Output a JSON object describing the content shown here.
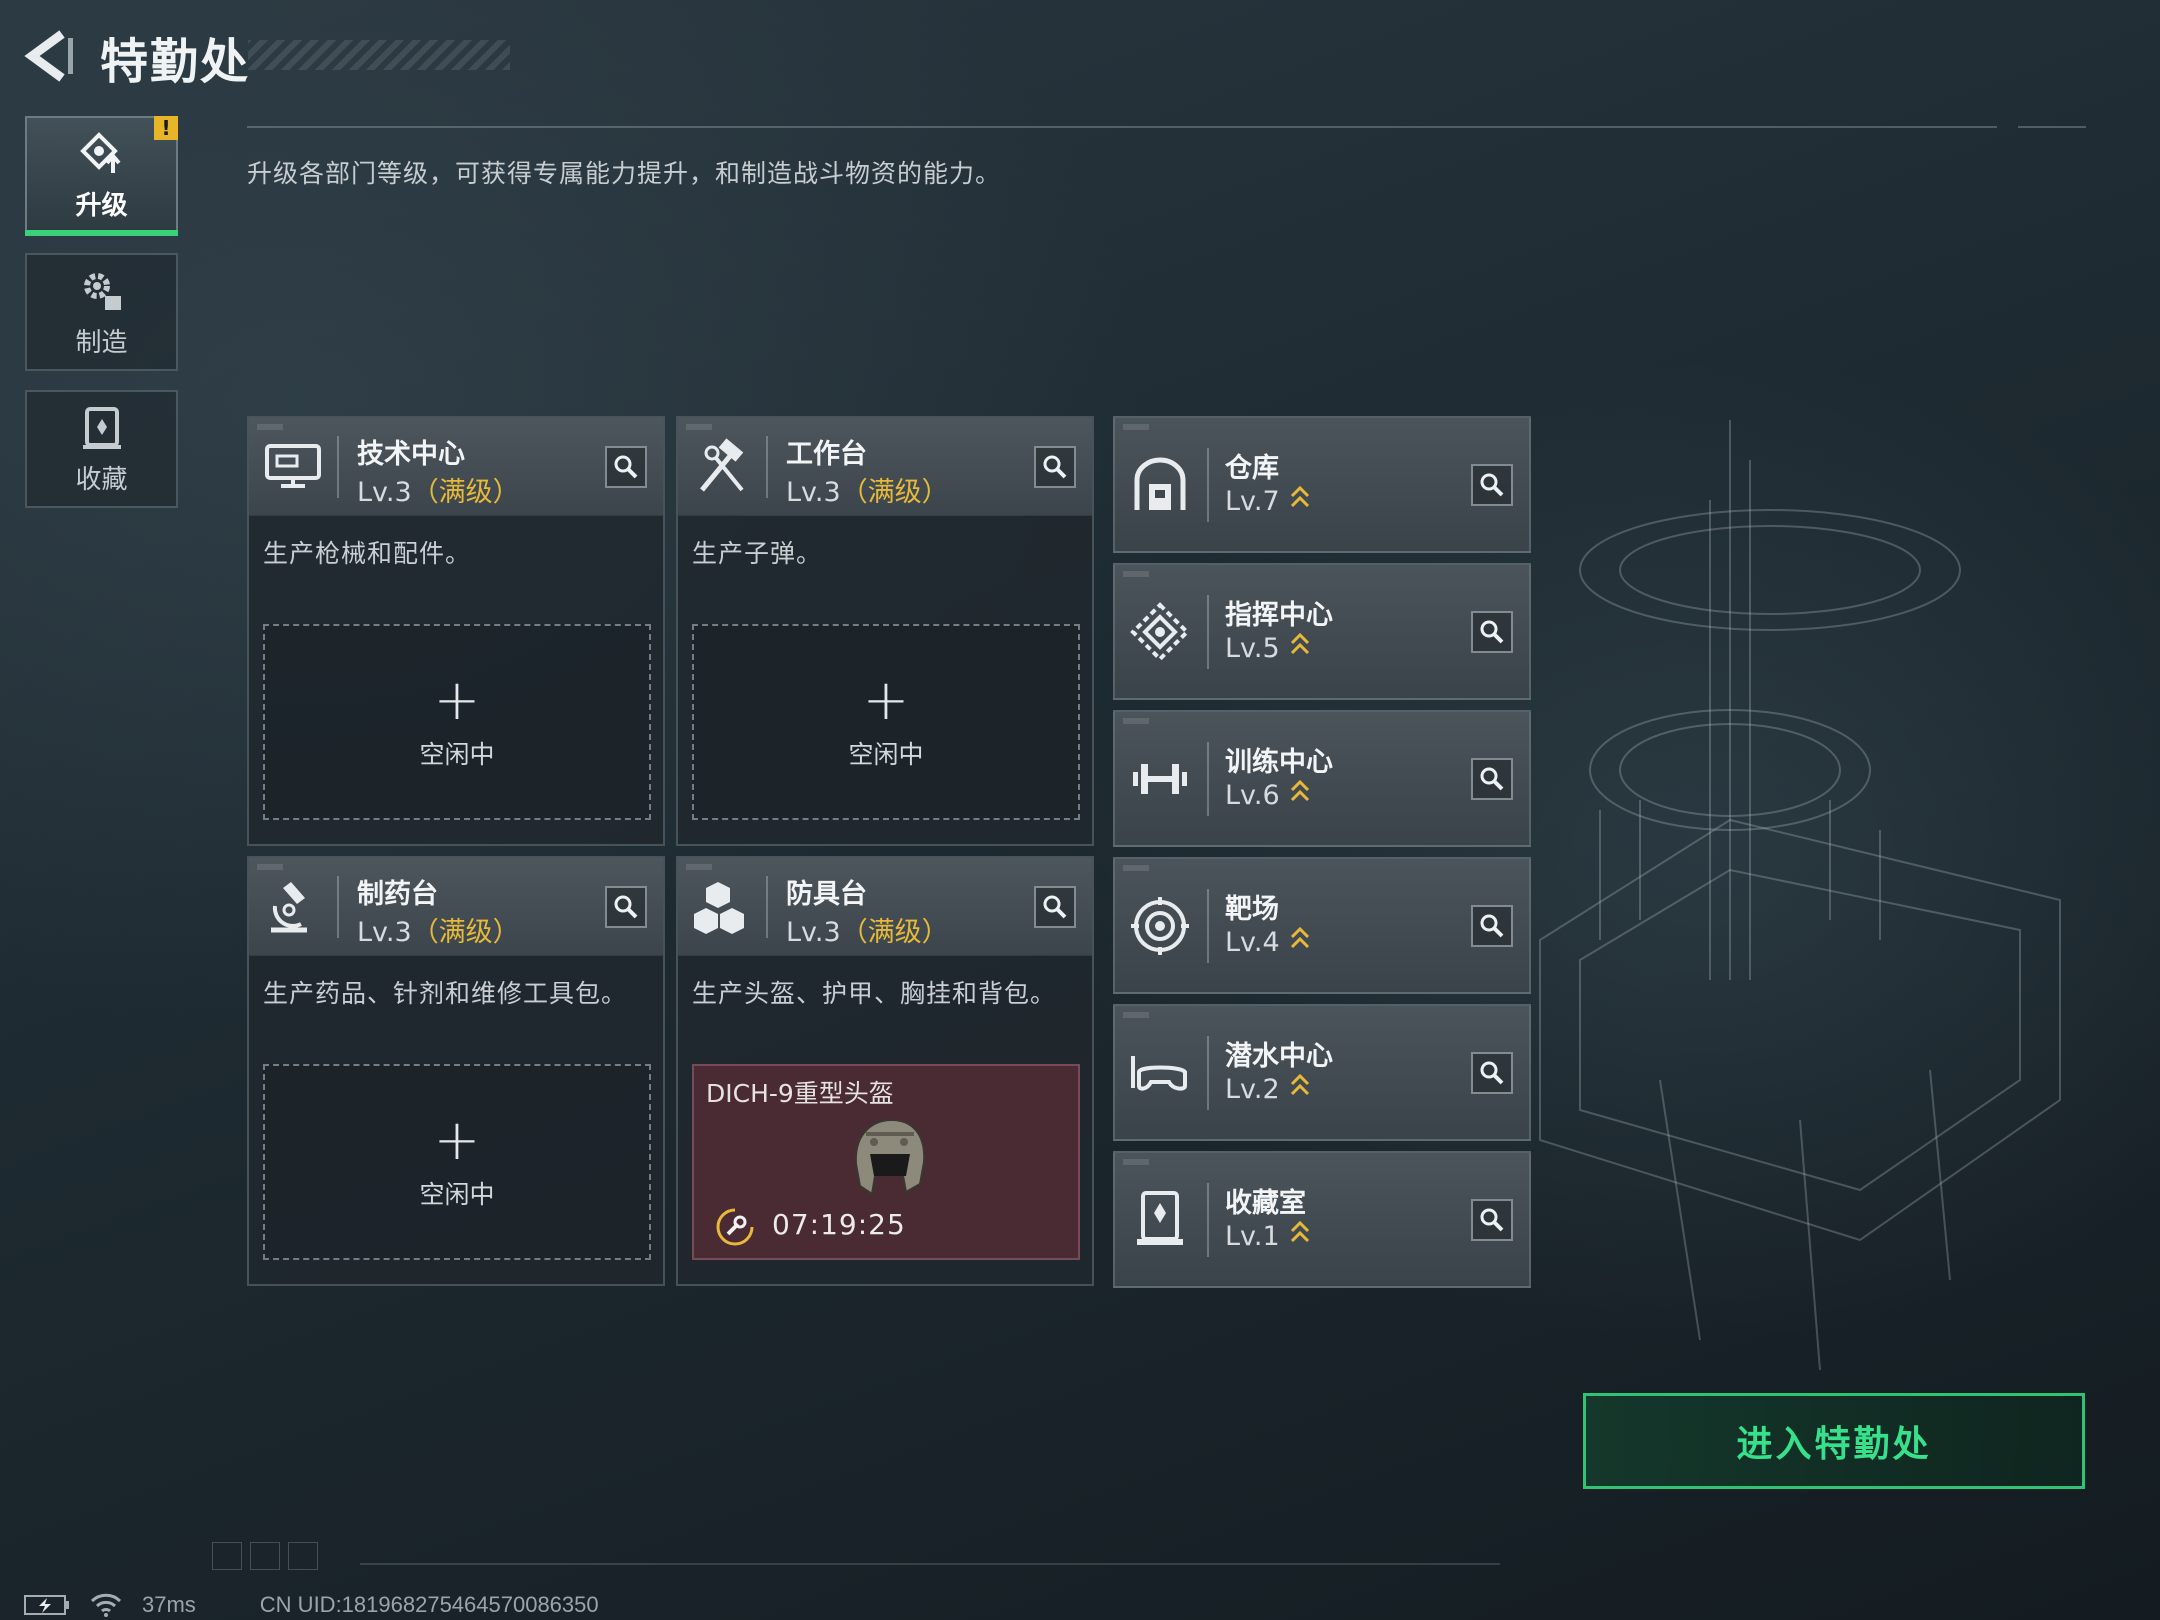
{
  "header": {
    "title": "特勤处"
  },
  "nav": {
    "tabs": [
      {
        "label": "升级",
        "active": true,
        "icon": "upgrade-icon"
      },
      {
        "label": "制造",
        "active": false,
        "icon": "gears-icon"
      },
      {
        "label": "收藏",
        "active": false,
        "icon": "collection-icon"
      }
    ],
    "alert": "!"
  },
  "description": "升级各部门等级，可获得专属能力提升，和制造战斗物资的能力。",
  "depts": [
    {
      "name": "技术中心",
      "level": "Lv.3",
      "maxed": "（满级）",
      "desc": "生产枪械和配件。",
      "slot_plus": "+",
      "slot_text": "空闲中",
      "icon": "computer-icon"
    },
    {
      "name": "工作台",
      "level": "Lv.3",
      "maxed": "（满级）",
      "desc": "生产子弹。",
      "slot_plus": "+",
      "slot_text": "空闲中",
      "icon": "hammer-wrench-icon"
    },
    {
      "name": "制药台",
      "level": "Lv.3",
      "maxed": "（满级）",
      "desc": "生产药品、针剂和维修工具包。",
      "slot_plus": "+",
      "slot_text": "空闲中",
      "icon": "microscope-icon"
    },
    {
      "name": "防具台",
      "level": "Lv.3",
      "maxed": "（满级）",
      "desc": "生产头盔、护甲、胸挂和背包。",
      "item_name": "DICH-9重型头盔",
      "timer": "07:19:25",
      "icon": "armor-blocks-icon"
    }
  ],
  "facilities": [
    {
      "name": "仓库",
      "level": "Lv.7",
      "icon": "warehouse-icon"
    },
    {
      "name": "指挥中心",
      "level": "Lv.5",
      "icon": "command-icon"
    },
    {
      "name": "训练中心",
      "level": "Lv.6",
      "icon": "dumbbell-icon"
    },
    {
      "name": "靶场",
      "level": "Lv.4",
      "icon": "target-icon"
    },
    {
      "name": "潜水中心",
      "level": "Lv.2",
      "icon": "diving-mask-icon"
    },
    {
      "name": "收藏室",
      "level": "Lv.1",
      "icon": "collection-room-icon"
    }
  ],
  "enter_button": "进入特勤处",
  "status": {
    "ping": "37ms",
    "uid": "CN UID:181968275464570086350"
  },
  "colors": {
    "accent_green": "#3ad17a",
    "gold": "#e6b93b",
    "craft_bg": "#4a2a33"
  }
}
